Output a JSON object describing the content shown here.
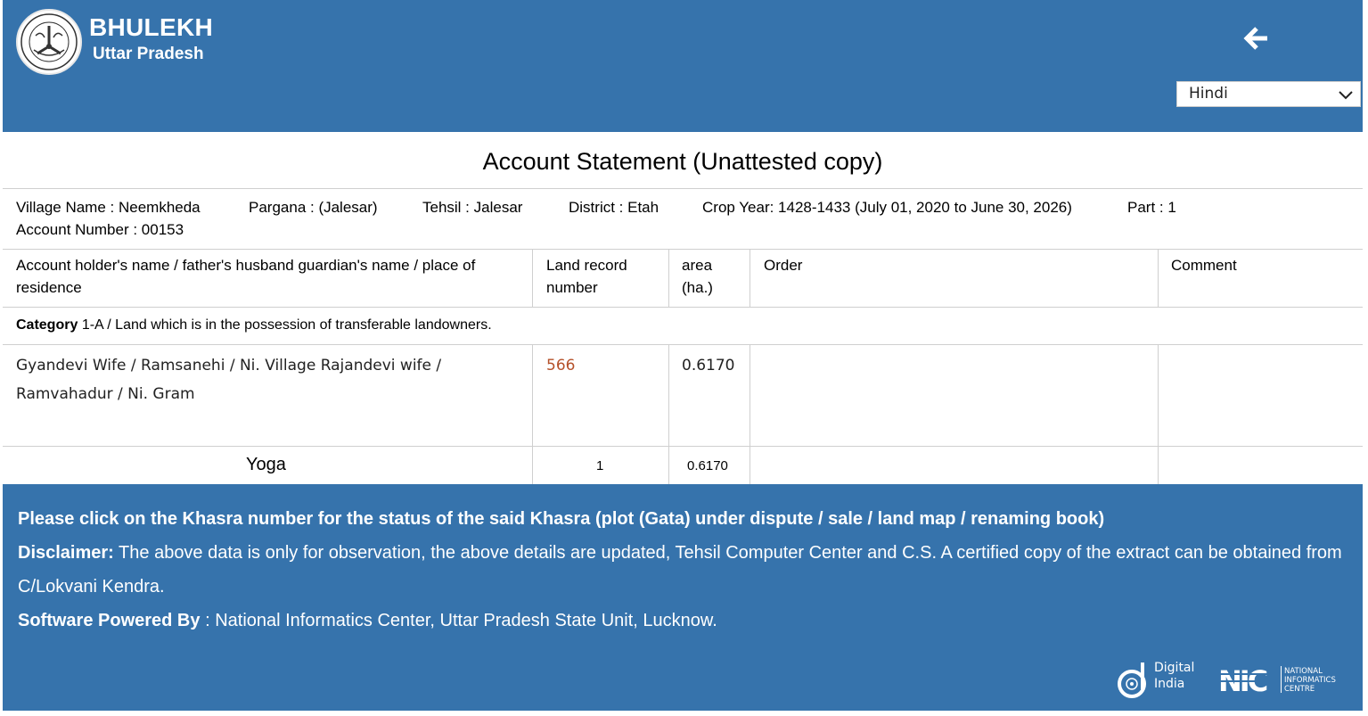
{
  "header": {
    "title": "BHULEKH",
    "subtitle": "Uttar Pradesh",
    "back_icon": "arrow-left-icon",
    "language": {
      "selected": "Hindi"
    }
  },
  "statement": {
    "title": "Account Statement (Unattested copy)",
    "village": "Village Name : Neemkheda",
    "pargana": "Pargana : (Jalesar)",
    "tehsil": "Tehsil : Jalesar",
    "district": "District : Etah",
    "crop_year": "Crop Year: 1428-1433 (July 01, 2020 to June 30, 2026)",
    "part": "Part : 1",
    "account_number": "Account Number : 00153"
  },
  "table": {
    "headers": {
      "holder": "Account holder's name / father's husband guardian's name / place of residence",
      "land_record": "Land record number",
      "area": "area (ha.)",
      "order": "Order",
      "comment": "Comment"
    },
    "category": {
      "label": "Category",
      "text": "1-A / Land which is in the possession of transferable landowners."
    },
    "row": {
      "holder": "Gyandevi Wife / Ramsanehi / Ni. Village Rajandevi wife / Ramvahadur / Ni. Gram",
      "land_record": "566",
      "area": "0.6170",
      "order": "",
      "comment": ""
    },
    "total": {
      "label": "Yoga",
      "count": "1",
      "area": "0.6170"
    }
  },
  "footer": {
    "notice": "Please click on the Khasra number for the status of the said Khasra (plot (Gata) under dispute / sale / land map / renaming book)",
    "disclaimer_label": "Disclaimer:",
    "disclaimer_text": "The above data is only for observation, the above details are updated, Tehsil Computer Center and C.S. A certified copy of the extract can be obtained from C/Lokvani Kendra.",
    "powered_label": "Software Powered By",
    "powered_text": ": National Informatics Center, Uttar Pradesh State Unit, Lucknow.",
    "digital_india": {
      "line1": "Digital",
      "line2": "India"
    },
    "nic": {
      "line1": "NATIONAL",
      "line2": "INFORMATICS",
      "line3": "CENTRE"
    }
  },
  "colors": {
    "brand_blue": "#3673ac",
    "link": "#b5512a",
    "border": "#cfcfcf"
  }
}
